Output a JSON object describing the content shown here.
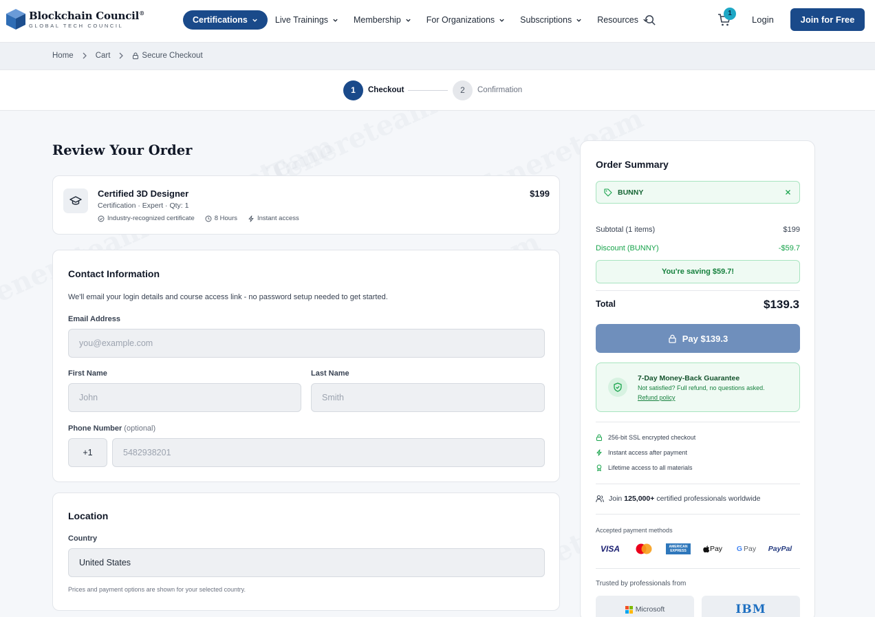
{
  "brand": {
    "name": "Blockchain Council",
    "reg": "®",
    "tagline": "GLOBAL TECH COUNCIL"
  },
  "nav": {
    "items": [
      {
        "label": "Certifications",
        "active": true
      },
      {
        "label": "Live Trainings"
      },
      {
        "label": "Membership"
      },
      {
        "label": "For Organizations"
      },
      {
        "label": "Subscriptions"
      },
      {
        "label": "Resources"
      }
    ],
    "cart_count": "1",
    "login": "Login",
    "join": "Join for Free"
  },
  "breadcrumb": {
    "home": "Home",
    "cart": "Cart",
    "current": "Secure Checkout"
  },
  "steps": [
    {
      "num": "1",
      "label": "Checkout"
    },
    {
      "num": "2",
      "label": "Confirmation"
    }
  ],
  "review": {
    "title": "Review Your Order",
    "product": {
      "name": "Certified 3D Designer",
      "meta": "Certification · Expert · Qty: 1",
      "price": "$199",
      "features": [
        "Industry-recognized certificate",
        "8 Hours",
        "Instant access"
      ]
    }
  },
  "contact": {
    "title": "Contact Information",
    "desc": "We'll email your login details and course access link - no password setup needed to get started.",
    "email_label": "Email Address",
    "email_placeholder": "you@example.com",
    "first_label": "First Name",
    "first_placeholder": "John",
    "last_label": "Last Name",
    "last_placeholder": "Smith",
    "phone_label": "Phone Number",
    "phone_optional": "(optional)",
    "phone_code": "+1",
    "phone_placeholder": "5482938201"
  },
  "location": {
    "title": "Location",
    "country_label": "Country",
    "country_value": "United States",
    "note": "Prices and payment options are shown for your selected country."
  },
  "summary": {
    "title": "Order Summary",
    "coupon": "BUNNY",
    "subtotal_label": "Subtotal (1 items)",
    "subtotal_value": "$199",
    "discount_label": "Discount (BUNNY)",
    "discount_value": "-$59.7",
    "saving": "You're saving $59.7!",
    "total_label": "Total",
    "total_value": "$139.3",
    "pay_label": "Pay $139.3",
    "guarantee_title": "7-Day Money-Back Guarantee",
    "guarantee_text": "Not satisfied? Full refund, no questions asked.",
    "guarantee_link": "Refund policy",
    "trust": [
      "256-bit SSL encrypted checkout",
      "Instant access after payment",
      "Lifetime access to all materials"
    ],
    "join_prefix": "Join",
    "join_count": "125,000+",
    "join_suffix": "certified professionals worldwide",
    "payment_label": "Accepted payment methods",
    "payment_methods": [
      "VISA",
      "AMERICAN EXPRESS",
      "Pay",
      "Pay",
      "PayPal"
    ],
    "trusted_label": "Trusted by professionals from",
    "trusted": [
      "Microsoft",
      "IBM"
    ]
  },
  "watermark": "Tenereteam",
  "colors": {
    "primary": "#1a4a8a",
    "success": "#16a34a",
    "pay_disabled": "#6f8fbc",
    "page_bg": "#f5f7fa"
  }
}
